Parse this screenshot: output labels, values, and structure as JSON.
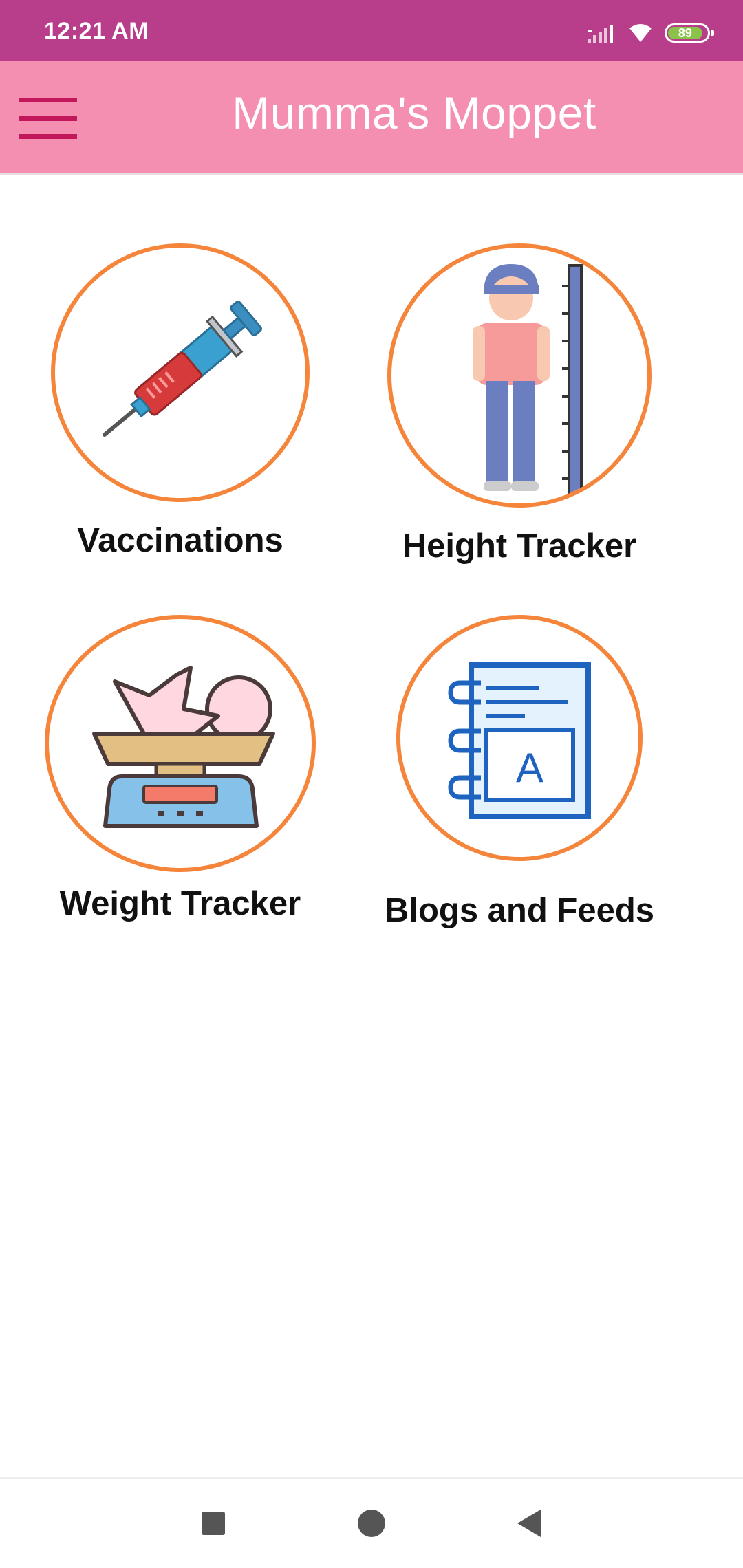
{
  "status_bar": {
    "time": "12:21 AM",
    "battery_level": "89",
    "icons": [
      "signal-icon",
      "wifi-icon",
      "battery-icon"
    ],
    "background_color": "#b83d8b"
  },
  "app_bar": {
    "title": "Mumma's Moppet",
    "menu_icon": "hamburger-menu-icon",
    "background_color": "#f48fb1",
    "menu_color": "#c2185b"
  },
  "features": [
    {
      "label": "Vaccinations",
      "icon": "syringe-icon"
    },
    {
      "label": "Height Tracker",
      "icon": "height-measure-icon"
    },
    {
      "label": "Weight Tracker",
      "icon": "baby-scale-icon"
    },
    {
      "label": "Blogs and Feeds",
      "icon": "notebook-icon"
    }
  ],
  "colors": {
    "circle_border": "#f5853a"
  },
  "nav_bar": {
    "buttons": [
      "recents-icon",
      "home-icon",
      "back-icon"
    ]
  }
}
